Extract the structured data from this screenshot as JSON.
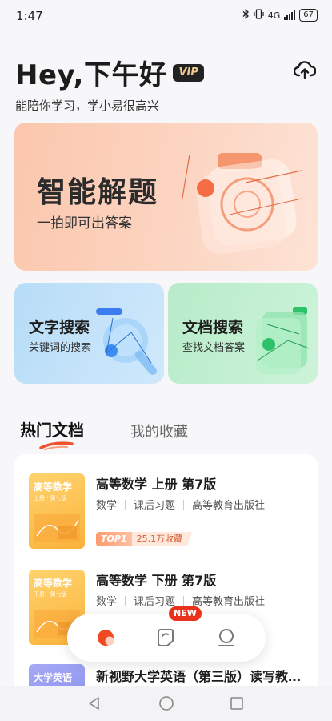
{
  "status": {
    "time": "1:47",
    "network": "4G",
    "battery": "67"
  },
  "header": {
    "greeting": "Hey,下午好",
    "vip": "VIP",
    "subtitle": "能陪你学习，学小易很高兴"
  },
  "cards": {
    "main": {
      "title": "智能解题",
      "subtitle": "一拍即可出答案"
    },
    "text_search": {
      "title": "文字搜索",
      "subtitle": "关键词的搜索"
    },
    "doc_search": {
      "title": "文档搜索",
      "subtitle": "查找文档答案"
    }
  },
  "tabs": [
    {
      "label": "热门文档",
      "active": true
    },
    {
      "label": "我的收藏",
      "active": false
    }
  ],
  "documents": [
    {
      "cover_title": "高等数学",
      "cover_sub": "上册 · 第七版",
      "title": "高等数学 上册 第7版",
      "tags": [
        "数学",
        "课后习题",
        "高等教育出版社"
      ],
      "rank": "TOP1",
      "favorites": "25.1万收藏"
    },
    {
      "cover_title": "高等数学",
      "cover_sub": "下册 · 第七版",
      "title": "高等数学 下册 第7版",
      "tags": [
        "数学",
        "课后习题",
        "高等教育出版社"
      ]
    },
    {
      "cover_title": "大学英语",
      "cover_sub": "",
      "title": "新视野大学英语（第三版）读写教…"
    }
  ],
  "nav": {
    "new_badge": "NEW"
  },
  "colors": {
    "accent": "#e8321c",
    "main_card": "#fcd0bb",
    "text_card": "#c2e2f9",
    "doc_card": "#c0efd0"
  },
  "icons": [
    "bluetooth-icon",
    "vibrate-icon",
    "signal-icon",
    "battery-icon",
    "cloud-upload-icon",
    "camera-icon",
    "search-icon",
    "document-icon",
    "home-icon",
    "docs-icon",
    "profile-icon",
    "back-icon",
    "home-circle-icon",
    "recent-icon"
  ]
}
